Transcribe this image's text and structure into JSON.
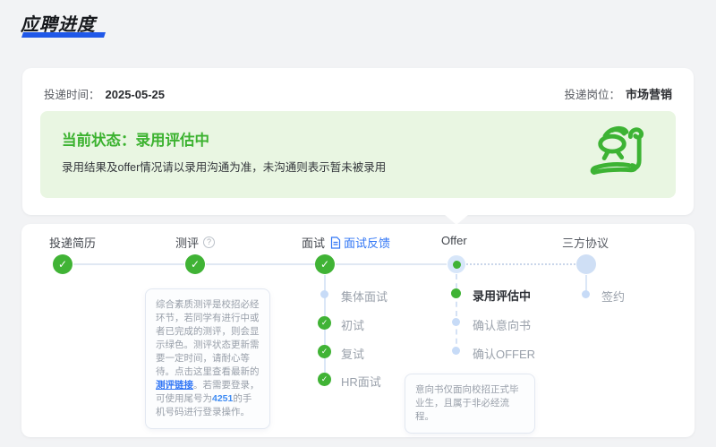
{
  "page": {
    "title": "应聘进度"
  },
  "card": {
    "submit_time_label": "投递时间：",
    "submit_time_value": "2025-05-25",
    "position_label": "投递岗位：",
    "position_value": "市场营销",
    "status": {
      "title": "当前状态：录用评估中",
      "desc": "录用结果及offer情况请以录用沟通为准，未沟通则表示暂未被录用",
      "icon": "offer-scroll-icon"
    }
  },
  "timeline": {
    "stages": [
      {
        "label": "投递简历",
        "status": "done"
      },
      {
        "label": "测评",
        "status": "done",
        "help_icon": "question-circle-icon"
      },
      {
        "label": "面试",
        "status": "done",
        "feedback_link": "面试反馈",
        "feedback_icon": "document-icon"
      },
      {
        "label": "Offer",
        "status": "current"
      },
      {
        "label": "三方协议",
        "status": "pending"
      }
    ],
    "substeps": {
      "interview": [
        {
          "label": "集体面试",
          "status": "pending"
        },
        {
          "label": "初试",
          "status": "done"
        },
        {
          "label": "复试",
          "status": "done"
        },
        {
          "label": "HR面试",
          "status": "done"
        }
      ],
      "offer": [
        {
          "label": "录用评估中",
          "status": "current"
        },
        {
          "label": "确认意向书",
          "status": "pending"
        },
        {
          "label": "确认OFFER",
          "status": "pending"
        }
      ],
      "agreement": [
        {
          "label": "签约",
          "status": "pending"
        }
      ]
    }
  },
  "tooltips": {
    "assessment": {
      "part1": "综合素质测评是校招必经环节，若同学有进行中或者已完成的测评，则会显示绿色。测评状态更新需要一定时间，请耐心等待。点击这里查看最新的",
      "link": "测评链接",
      "part2": "。若需要登录，可使用尾号为",
      "phone_tail": "4251",
      "part3": "的手机号码进行登录操作。"
    },
    "offer_note": "意向书仅面向校招正式毕业生，且属于非必经流程。"
  },
  "colors": {
    "accent_green": "#40b335",
    "status_banner_bg": "#e9f6e2",
    "link_blue": "#3176f5",
    "title_underline_blue": "#2058e8",
    "pending_node_blue": "#cfdff5"
  }
}
